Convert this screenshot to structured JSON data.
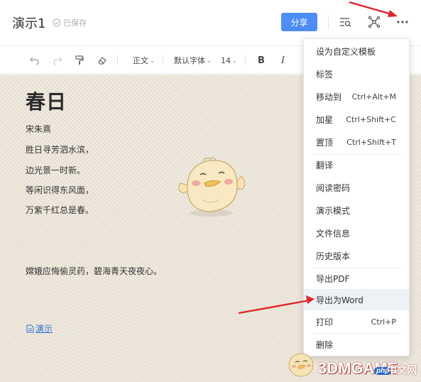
{
  "header": {
    "doc_title": "演示1",
    "saved_status": "已保存",
    "share_label": "分享",
    "icons": [
      "outline-search-icon",
      "mindmap-icon",
      "more-icon"
    ]
  },
  "toolbar": {
    "paragraph_style": "正文",
    "font_family": "默认字体",
    "font_size": "14",
    "bold_label": "B",
    "italic_label": "I"
  },
  "document": {
    "title": "春日",
    "author": "宋朱熹",
    "lines": [
      "胜日寻芳泗水滨，",
      "边光景一时新。",
      "等闲识得东风面，",
      "万紫千红总是春。"
    ],
    "extra_line": "嫦娥应悔偷灵药，碧海青天夜夜心。",
    "link_label": "演示"
  },
  "menu": {
    "items": [
      {
        "label": "设为自定义模板",
        "shortcut": ""
      },
      {
        "label": "标签",
        "shortcut": ""
      },
      {
        "label": "移动到",
        "shortcut": "Ctrl+Alt+M"
      },
      {
        "label": "加星",
        "shortcut": "Ctrl+Shift+C"
      },
      {
        "label": "置顶",
        "shortcut": "Ctrl+Shift+T"
      },
      {
        "label": "翻译",
        "shortcut": ""
      },
      {
        "label": "阅读密码",
        "shortcut": ""
      },
      {
        "label": "演示模式",
        "shortcut": ""
      },
      {
        "label": "文件信息",
        "shortcut": ""
      },
      {
        "label": "历史版本",
        "shortcut": ""
      },
      {
        "label": "导出PDF",
        "shortcut": ""
      },
      {
        "label": "导出为Word",
        "shortcut": ""
      },
      {
        "label": "打印",
        "shortcut": "Ctrl+P"
      },
      {
        "label": "删除",
        "shortcut": ""
      }
    ],
    "highlighted_item": "导出为Word"
  },
  "watermark": {
    "brand": "3DMGAME",
    "site": "中文网",
    "php_badge": "php"
  },
  "colors": {
    "accent": "#4d8df7",
    "link": "#2f6fd6",
    "annotation_arrow": "#e0262a",
    "canvas_bg": "#ece6da"
  }
}
